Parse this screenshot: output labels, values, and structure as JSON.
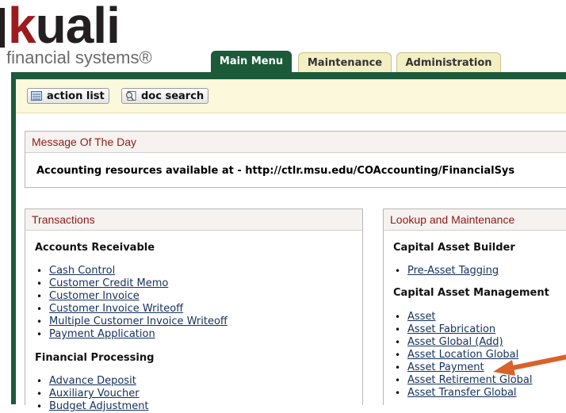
{
  "header": {
    "logo_word": "kuali",
    "logo_first": "k",
    "logo_rest": "uali",
    "logo_sub": "financial systems®",
    "tabs": [
      "Main Menu",
      "Maintenance",
      "Administration"
    ]
  },
  "toolbar": {
    "action_list": "action list",
    "doc_search": "doc search"
  },
  "motd": {
    "title": "Message Of The Day",
    "text": "Accounting resources available at - http://ctlr.msu.edu/COAccounting/FinancialSys"
  },
  "transactions": {
    "title": "Transactions",
    "sections": [
      {
        "heading": "Accounts Receivable",
        "links": [
          "Cash Control",
          "Customer Credit Memo",
          "Customer Invoice",
          "Customer Invoice Writeoff",
          "Multiple Customer Invoice Writeoff",
          "Payment Application"
        ]
      },
      {
        "heading": "Financial Processing",
        "links": [
          "Advance Deposit",
          "Auxiliary Voucher",
          "Budget Adjustment"
        ]
      }
    ]
  },
  "lookup": {
    "title": "Lookup and Maintenance",
    "sections": [
      {
        "heading": "Capital Asset Builder",
        "links": [
          "Pre-Asset Tagging"
        ]
      },
      {
        "heading": "Capital Asset Management",
        "links": [
          "Asset",
          "Asset Fabrication",
          "Asset Global (Add)",
          "Asset Location Global",
          "Asset Payment",
          "Asset Retirement Global",
          "Asset Transfer Global"
        ]
      }
    ]
  },
  "colors": {
    "brand_green": "#1c5a3a",
    "brand_red": "#9b1b1f",
    "link": "#14305e",
    "annotation_arrow": "#d9622b"
  }
}
